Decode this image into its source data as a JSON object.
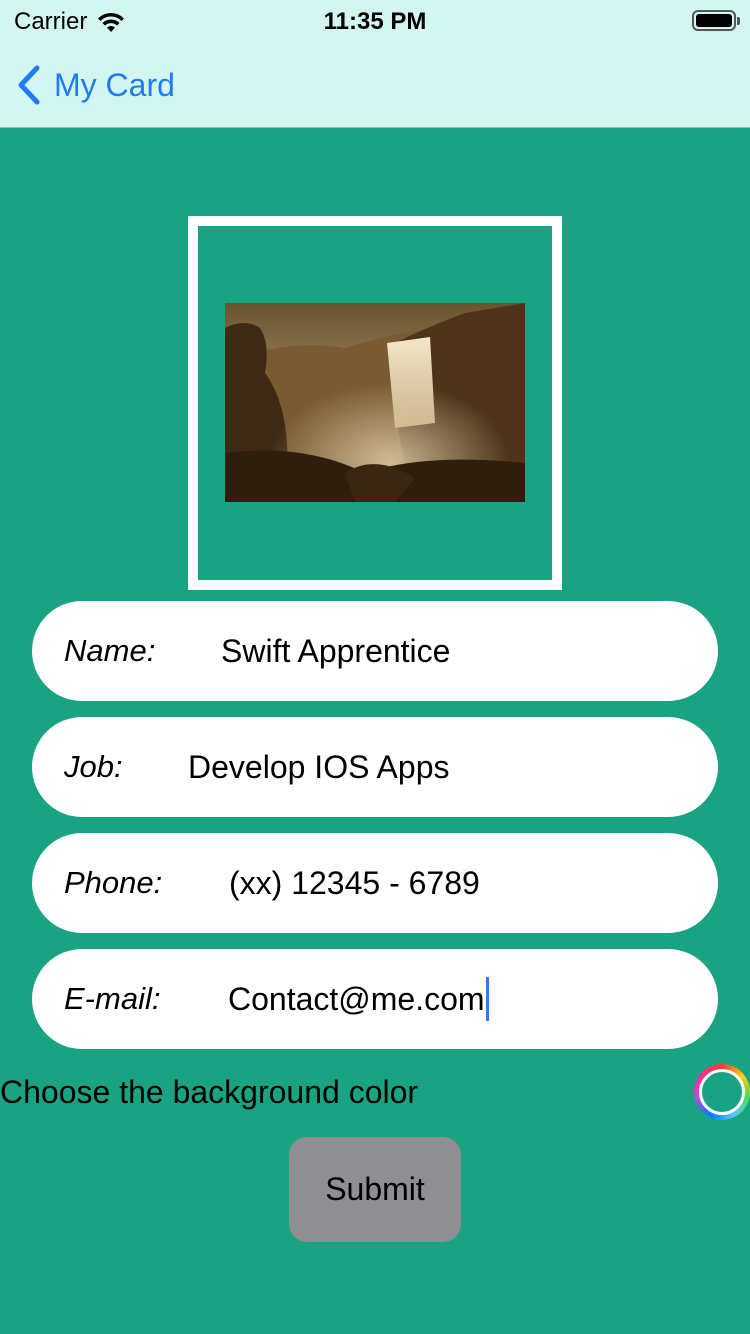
{
  "status_bar": {
    "carrier": "Carrier",
    "time": "11:35 PM"
  },
  "nav": {
    "back_label": "My Card"
  },
  "photo": {
    "description_icon": "waterfall-photo"
  },
  "fields": [
    {
      "label": "Name:",
      "value": "Swift Apprentice"
    },
    {
      "label": "Job:",
      "value": "Develop IOS Apps"
    },
    {
      "label": "Phone:",
      "value": "(xx) 12345 - 6789"
    },
    {
      "label": "E-mail:",
      "value": "Contact@me.com"
    }
  ],
  "background_color": {
    "label": "Choose the background color",
    "current": "#1aa383"
  },
  "submit_label": "Submit",
  "colors": {
    "accent": "#1e7df5",
    "nav_background": "#d4f6f0",
    "page_background": "#1aa383",
    "button_background": "#8e8e93"
  }
}
